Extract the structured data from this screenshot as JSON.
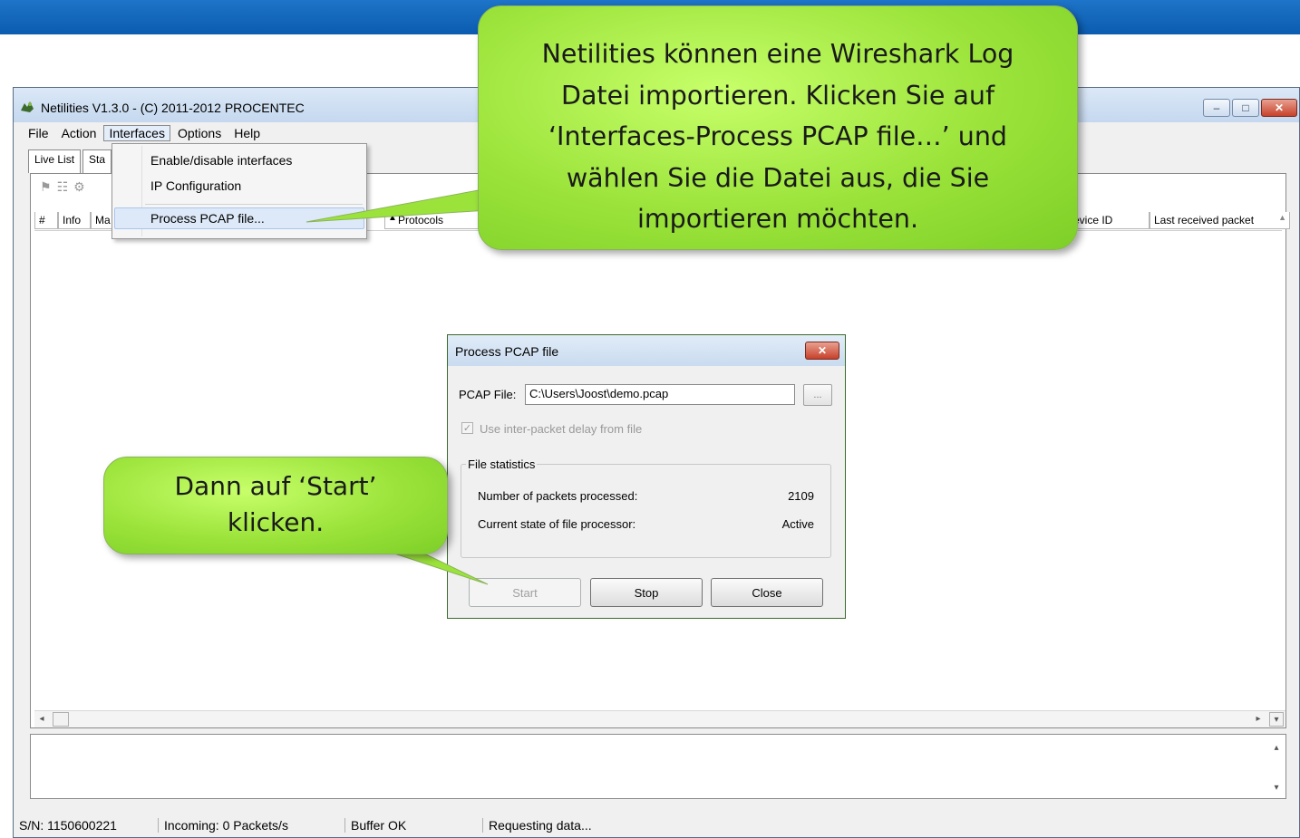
{
  "window": {
    "title": "Netilities V1.3.0 - (C) 2011-2012 PROCENTEC",
    "controls": [
      "minimize",
      "maximize",
      "close"
    ]
  },
  "menubar": [
    "File",
    "Action",
    "Interfaces",
    "Options",
    "Help"
  ],
  "interfaces_menu": {
    "items": [
      "Enable/disable interfaces",
      "IP Configuration",
      "Process PCAP file..."
    ],
    "highlighted": "Process PCAP file..."
  },
  "tabs": [
    "Live List",
    "Sta"
  ],
  "table": {
    "columns_left": [
      "#",
      "Info",
      "Ma"
    ],
    "protocols": "Protocols",
    "device_id": "evice ID",
    "last_received": "Last received packet"
  },
  "dialog": {
    "title": "Process PCAP file",
    "pcap_label": "PCAP File:",
    "pcap_value": "C:\\Users\\Joost\\demo.pcap",
    "browse": "...",
    "delay_label": "Use inter-packet delay from file",
    "delay_checked": true,
    "group_title": "File statistics",
    "packets_label": "Number of packets processed:",
    "packets_value": "2109",
    "state_label": "Current state of file processor:",
    "state_value": "Active",
    "buttons": {
      "start": "Start",
      "stop": "Stop",
      "close": "Close"
    }
  },
  "statusbar": {
    "serial": "S/N: 1150600221",
    "incoming": "Incoming: 0 Packets/s",
    "buffer": "Buffer OK",
    "state": "Requesting data..."
  },
  "callouts": {
    "top": [
      "Netilities können eine Wireshark Log",
      "Datei importieren. Klicken Sie auf",
      "‘Interfaces-Process PCAP file…’ und",
      "wählen Sie die Datei aus, die Sie",
      "importieren möchten."
    ],
    "bottom": [
      "Dann auf ‘Start’",
      "klicken."
    ]
  },
  "colors": {
    "band": "#0b5cb0",
    "callout": "#9be33a",
    "highlight": "#dde9f8"
  }
}
